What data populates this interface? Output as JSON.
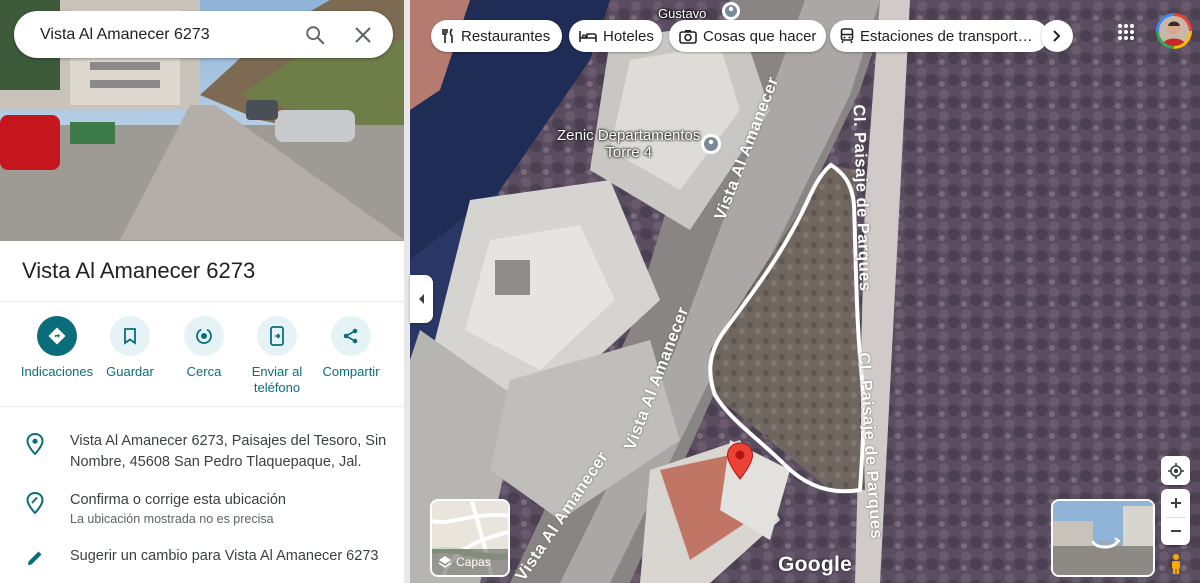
{
  "search": {
    "value": "Vista Al Amanecer 6273"
  },
  "place": {
    "title": "Vista Al Amanecer 6273"
  },
  "actions": [
    {
      "label": "Indicaciones",
      "icon": "directions-icon"
    },
    {
      "label": "Guardar",
      "icon": "bookmark-icon"
    },
    {
      "label": "Cerca",
      "icon": "nearby-icon"
    },
    {
      "label": "Enviar al teléfono",
      "icon": "send-to-phone-icon"
    },
    {
      "label": "Compartir",
      "icon": "share-icon"
    }
  ],
  "info": {
    "address": "Vista Al Amanecer 6273, Paisajes del Tesoro, Sin Nombre, 45608 San Pedro Tlaquepaque, Jal.",
    "confirm_title": "Confirma o corrige esta ubicación",
    "confirm_sub": "La ubicación mostrada no es precisa",
    "suggest": "Sugerir un cambio para Vista Al Amanecer 6273"
  },
  "chips": [
    {
      "label": "Restaurantes",
      "icon": "restaurant-icon"
    },
    {
      "label": "Hoteles",
      "icon": "hotel-icon"
    },
    {
      "label": "Cosas que hacer",
      "icon": "camera-icon"
    },
    {
      "label": "Estaciones de transport…",
      "icon": "transit-icon"
    }
  ],
  "map": {
    "poi_gustavo": "Gustavo",
    "poi_zenic_line1": "Zenic Departamentos",
    "poi_zenic_line2": "Torre 4",
    "street_main_1": "Vista Al Amanecer",
    "street_main_2": "Vista Al Amanecer",
    "street_main_3": "Vista Al Amanecer",
    "street_paisaje_1": "Cl. Paisaje de Parques",
    "street_paisaje_2": "Cl. Paisaje de Parques",
    "layers_label": "Capas",
    "logo": "Google"
  },
  "colors": {
    "accent": "#0a6e7a",
    "pin": "#ea4335"
  }
}
